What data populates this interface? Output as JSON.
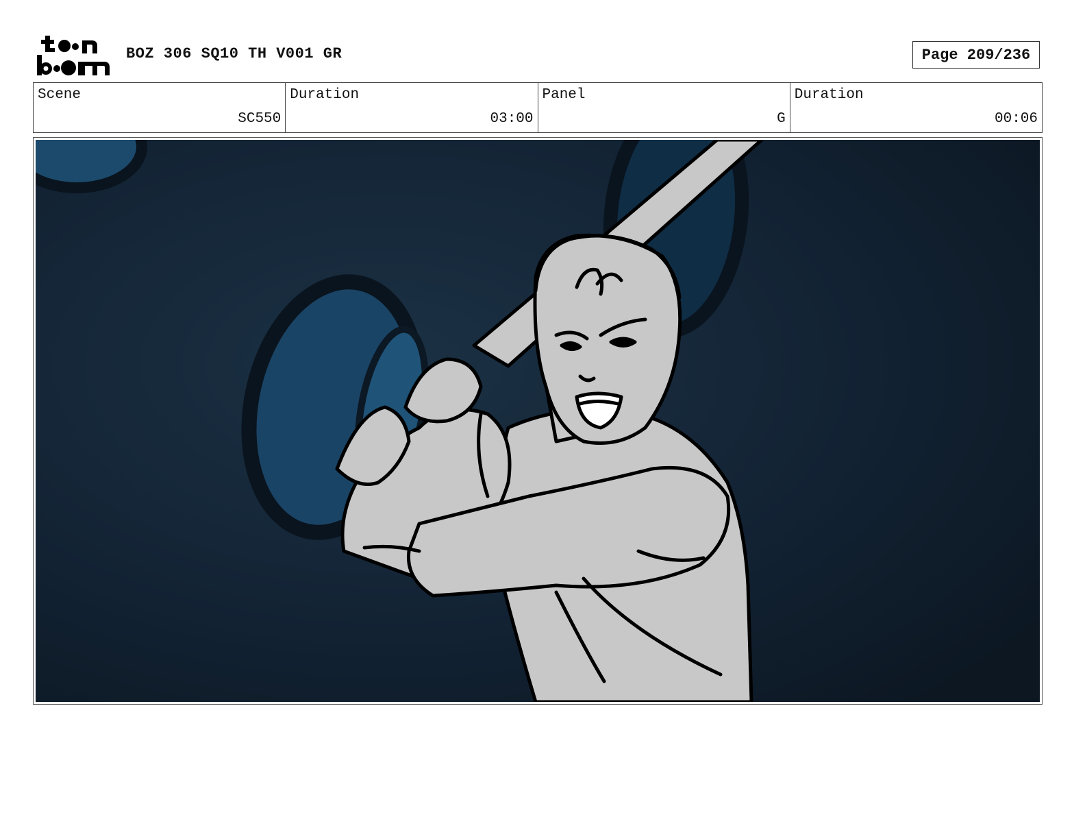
{
  "header": {
    "logo_text": "toon boom",
    "title": "BOZ 306 SQ10 TH V001 GR",
    "page": "Page 209/236"
  },
  "info": {
    "scene_label": "Scene",
    "scene_value": "SC550",
    "scene_duration_label": "Duration",
    "scene_duration_value": "03:00",
    "panel_label": "Panel",
    "panel_value": "G",
    "panel_duration_label": "Duration",
    "panel_duration_value": "00:06"
  },
  "colors": {
    "background_dark": "#10202e",
    "background_blue": "#1c4a6c",
    "sketch_fill": "#c8c8c8",
    "line": "#000000"
  }
}
